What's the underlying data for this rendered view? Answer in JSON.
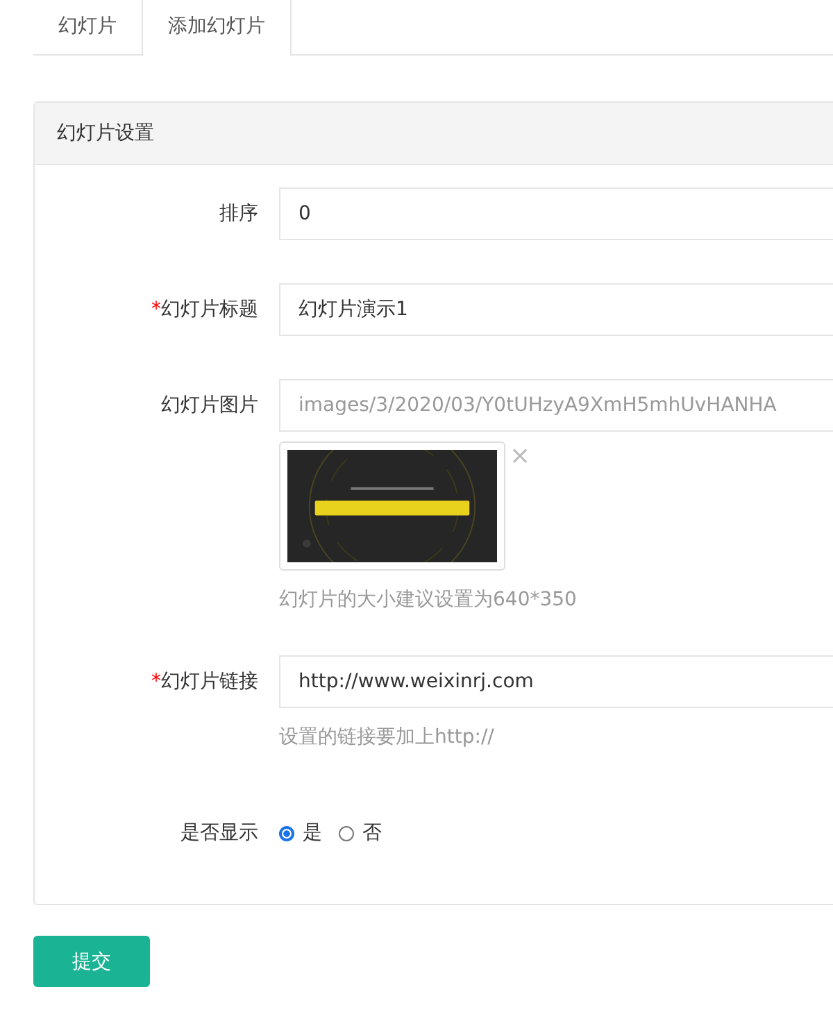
{
  "tabs": [
    {
      "label": "幻灯片",
      "selected": false
    },
    {
      "label": "添加幻灯片",
      "selected": true
    }
  ],
  "panel": {
    "title": "幻灯片设置",
    "fields": [
      {
        "kind": "text",
        "label": "排序",
        "value": "0"
      },
      {
        "kind": "text",
        "required_mark": "*",
        "label": "幻灯片标题",
        "value": "幻灯片演示1"
      },
      {
        "label": "幻灯片图片",
        "value": "images/3/2020/03/Y0tUHzyA9XmH5mhUvHANHA",
        "remove": "×",
        "help": "幻灯片的大小建议设置为640*350"
      },
      {
        "kind": "text",
        "required_mark": "*",
        "label": "幻灯片链接",
        "value": "http://www.weixinrj.com",
        "help": "设置的链接要加上http://"
      },
      {
        "kind": "radio",
        "label": "是否显示",
        "options": [
          {
            "label": "是",
            "selected": true
          },
          {
            "label": "否",
            "selected": false
          }
        ]
      }
    ]
  },
  "submit": "提交"
}
